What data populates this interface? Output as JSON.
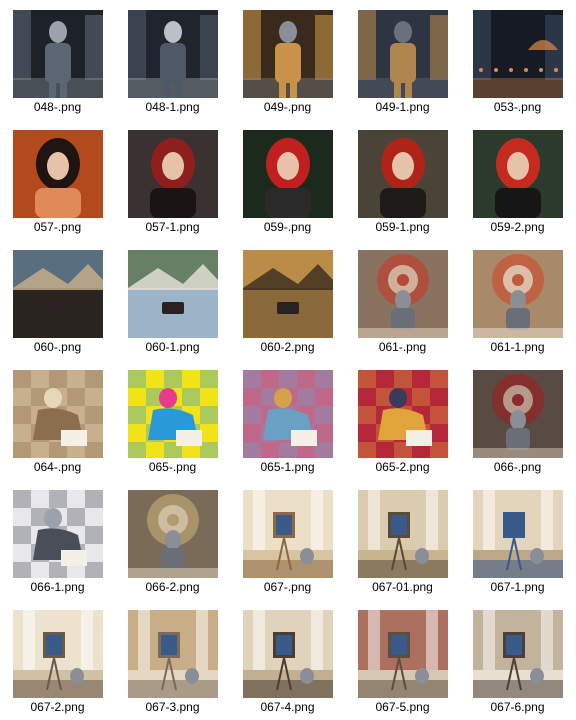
{
  "files": [
    {
      "name": "048-.png",
      "scene": "robot-city-duo",
      "palette": [
        "#1d2229",
        "#5c6573",
        "#9aa3ad"
      ]
    },
    {
      "name": "048-1.png",
      "scene": "robot-city-duo",
      "palette": [
        "#20252d",
        "#4f5866",
        "#b8c0c8"
      ]
    },
    {
      "name": "049-.png",
      "scene": "robot-street-night",
      "palette": [
        "#3a2a1c",
        "#c8924a",
        "#8a8f99"
      ]
    },
    {
      "name": "049-1.png",
      "scene": "robot-street-night",
      "palette": [
        "#2e3540",
        "#b08650",
        "#6a717d"
      ]
    },
    {
      "name": "053-.png",
      "scene": "city-night",
      "palette": [
        "#151a24",
        "#3b4a63",
        "#d98b4a"
      ]
    },
    {
      "name": "057-.png",
      "scene": "red-hair-portrait",
      "palette": [
        "#b34a1e",
        "#1f1412",
        "#e08a5a"
      ]
    },
    {
      "name": "057-1.png",
      "scene": "red-hair-portrait",
      "palette": [
        "#3a3230",
        "#8f1e1e",
        "#1a1414"
      ]
    },
    {
      "name": "059-.png",
      "scene": "red-hood-portrait",
      "palette": [
        "#1c2a1e",
        "#c02020",
        "#2a2a2a"
      ]
    },
    {
      "name": "059-1.png",
      "scene": "red-hood-portrait",
      "palette": [
        "#4a4438",
        "#b02418",
        "#1e1a18"
      ]
    },
    {
      "name": "059-2.png",
      "scene": "red-hood-portrait",
      "palette": [
        "#2c3a2c",
        "#c42a1e",
        "#161616"
      ]
    },
    {
      "name": "060-.png",
      "scene": "model-railway-room",
      "palette": [
        "#2a2420",
        "#6e8fa8",
        "#c9b08a"
      ]
    },
    {
      "name": "060-1.png",
      "scene": "mountain-railway",
      "palette": [
        "#9cb4c8",
        "#4e6a3a",
        "#e8e4dc"
      ]
    },
    {
      "name": "060-2.png",
      "scene": "autumn-train",
      "palette": [
        "#8a6a3a",
        "#d09a4e",
        "#3a2a1e"
      ]
    },
    {
      "name": "061-.png",
      "scene": "robot-mandala-studio",
      "palette": [
        "#8a7260",
        "#b54a3a",
        "#d8c8b0"
      ]
    },
    {
      "name": "061-1.png",
      "scene": "robot-mandala-studio",
      "palette": [
        "#a88a6a",
        "#c25a3c",
        "#e4d6c4"
      ]
    },
    {
      "name": "064-.png",
      "scene": "sepia-sketch",
      "palette": [
        "#c8b08e",
        "#8a6e4e",
        "#e6d6ba"
      ]
    },
    {
      "name": "065-.png",
      "scene": "pop-art-reader",
      "palette": [
        "#f2e21a",
        "#2a9ad6",
        "#e63a8a"
      ]
    },
    {
      "name": "065-1.png",
      "scene": "mosaic-reader",
      "palette": [
        "#c0688a",
        "#6aa0c4",
        "#d8a04a"
      ]
    },
    {
      "name": "065-2.png",
      "scene": "mosaic-chair",
      "palette": [
        "#b4283a",
        "#e0a43a",
        "#3a3a5a"
      ]
    },
    {
      "name": "066-.png",
      "scene": "robot-mandala-wall",
      "palette": [
        "#5a4a44",
        "#8a2a2a",
        "#c4b4a4"
      ]
    },
    {
      "name": "066-1.png",
      "scene": "robot-floor-drawing",
      "palette": [
        "#e8e8ea",
        "#4a4e58",
        "#9aa2ac"
      ]
    },
    {
      "name": "066-2.png",
      "scene": "robot-meditation",
      "palette": [
        "#7a6a58",
        "#b09a6e",
        "#d6c8b2"
      ]
    },
    {
      "name": "067-.png",
      "scene": "painting-studio",
      "palette": [
        "#d8c4a0",
        "#8a6a44",
        "#f0e6d2"
      ]
    },
    {
      "name": "067-01.png",
      "scene": "painting-studio",
      "palette": [
        "#c8b48e",
        "#5a4a38",
        "#e0d2b8"
      ]
    },
    {
      "name": "067-1.png",
      "scene": "painting-studio",
      "palette": [
        "#bca888",
        "#3a5a8a",
        "#ece0c8"
      ]
    },
    {
      "name": "067-2.png",
      "scene": "studio-mess",
      "palette": [
        "#d0c0a4",
        "#6a5a4a",
        "#f2ead8"
      ]
    },
    {
      "name": "067-3.png",
      "scene": "studio-mess",
      "palette": [
        "#e4d8c2",
        "#7a6a5a",
        "#c0a478"
      ]
    },
    {
      "name": "067-4.png",
      "scene": "studio-mess",
      "palette": [
        "#c2ae90",
        "#4a3e34",
        "#e8dcc6"
      ]
    },
    {
      "name": "067-5.png",
      "scene": "studio-mess",
      "palette": [
        "#d6c8b0",
        "#5e4e40",
        "#a45a4a"
      ]
    },
    {
      "name": "067-6.png",
      "scene": "studio-mess",
      "palette": [
        "#e8e0d0",
        "#4a4038",
        "#b8a890"
      ]
    }
  ]
}
